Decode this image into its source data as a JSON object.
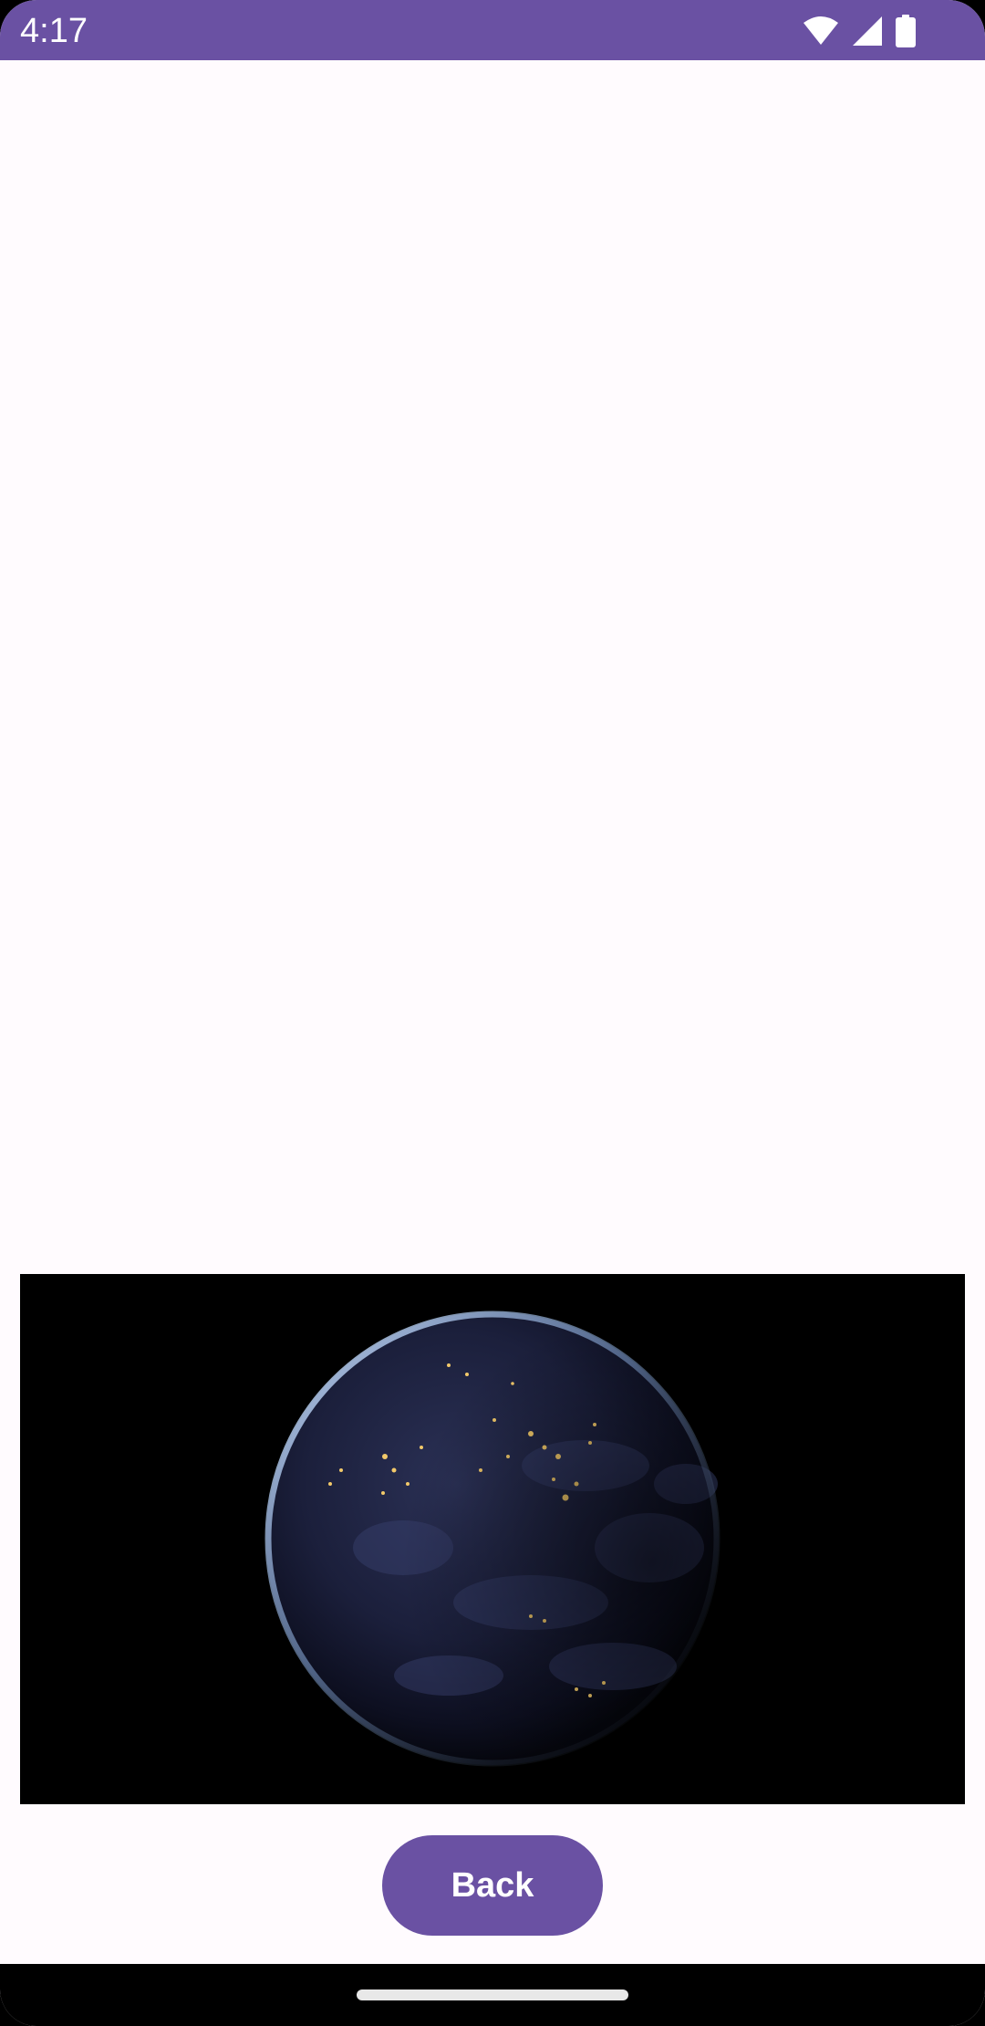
{
  "status_bar": {
    "time": "4:17",
    "icons": [
      "wifi-icon",
      "cellular-signal-icon",
      "battery-icon"
    ],
    "background": "#6a51a3"
  },
  "media": {
    "subject": "earth-at-night-icon",
    "background": "#000000"
  },
  "actions": {
    "back_label": "Back",
    "button_color": "#6a51a3"
  },
  "nav_bar": {
    "handle": "home-gesture-handle"
  }
}
